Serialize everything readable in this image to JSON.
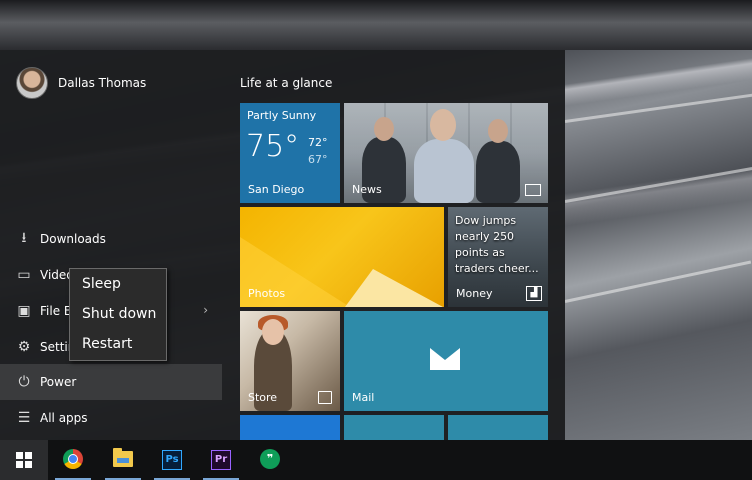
{
  "start_menu": {
    "user_name": "Dallas Thomas",
    "left_items": [
      {
        "label": "Downloads",
        "icon": "download-icon"
      },
      {
        "label": "Videos",
        "icon": "video-icon"
      },
      {
        "label": "File Explorer",
        "icon": "folder-icon"
      },
      {
        "label": "Settings",
        "icon": "gear-icon"
      },
      {
        "label": "Power",
        "icon": "power-icon"
      },
      {
        "label": "All apps",
        "icon": "list-icon"
      }
    ],
    "group_title": "Life at a glance"
  },
  "tiles": {
    "weather": {
      "condition": "Partly Sunny",
      "temp": "75°",
      "high": "72°",
      "low": "67°",
      "city": "San Diego"
    },
    "news": {
      "label": "News"
    },
    "photos": {
      "label": "Photos"
    },
    "money": {
      "headline": "Dow jumps nearly 250 points as traders cheer...",
      "label": "Money"
    },
    "store": {
      "label": "Store"
    },
    "mail": {
      "label": "Mail"
    }
  },
  "power_menu": {
    "items": [
      "Sleep",
      "Shut down",
      "Restart"
    ]
  },
  "taskbar": {
    "apps": [
      "chrome-icon",
      "file-explorer-icon",
      "photoshop-icon",
      "premiere-icon",
      "hangouts-icon"
    ],
    "ps_text": "Ps",
    "pr_text": "Pr",
    "hangouts_text": "❞"
  },
  "colors": {
    "weather_tile": "#1f73a8",
    "mail_tile": "#2e8ba9",
    "photos_tile": "#f4b400"
  }
}
